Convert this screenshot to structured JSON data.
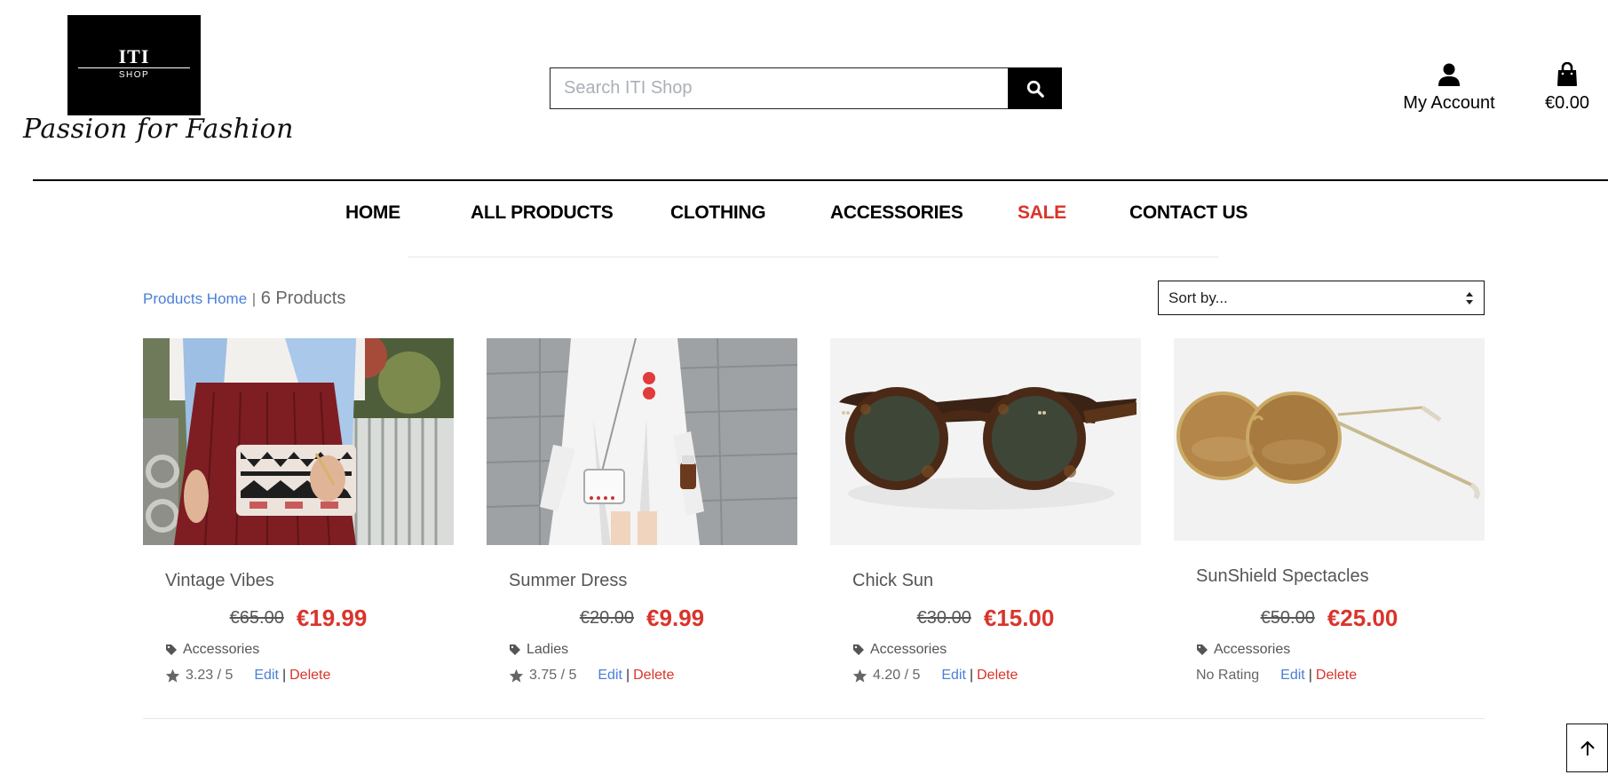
{
  "logo": {
    "brand": "ITI",
    "sub": "SHOP",
    "tagline": "Passion for Fashion"
  },
  "search": {
    "placeholder": "Search ITI Shop",
    "value": "",
    "icon": "search-icon"
  },
  "account": {
    "label": "My Account",
    "icon": "user-icon"
  },
  "cart": {
    "total": "€0.00",
    "icon": "shopping-bag-icon"
  },
  "nav": {
    "items": [
      {
        "label": "HOME"
      },
      {
        "label": "ALL PRODUCTS"
      },
      {
        "label": "CLOTHING"
      },
      {
        "label": "ACCESSORIES"
      },
      {
        "label": "SALE",
        "color": "#d9342b"
      },
      {
        "label": "CONTACT US"
      }
    ]
  },
  "toolbar": {
    "breadcrumb_link": "Products Home",
    "separator": "|",
    "product_count": "6 Products",
    "sort_label": "Sort by..."
  },
  "products": [
    {
      "title": "Vintage Vibes",
      "old_price": "€65.00",
      "price": "€19.99",
      "category": "Accessories",
      "rating": "3.23 / 5",
      "image": "woman-with-clutch-bag"
    },
    {
      "title": "Summer Dress",
      "old_price": "€20.00",
      "price": "€9.99",
      "category": "Ladies",
      "rating": "3.75 / 5",
      "image": "woman-in-white-dress"
    },
    {
      "title": "Chick Sun",
      "old_price": "€30.00",
      "price": "€15.00",
      "category": "Accessories",
      "rating": "4.20 / 5",
      "image": "tortoiseshell-sunglasses"
    },
    {
      "title": "SunShield Spectacles",
      "old_price": "€50.00",
      "price": "€25.00",
      "category": "Accessories",
      "rating": "No Rating",
      "image": "gold-round-sunglasses"
    }
  ],
  "actions": {
    "edit": "Edit",
    "delete": "Delete",
    "separator": "|"
  },
  "colors": {
    "accent_red": "#d9342b",
    "link_blue": "#4a7fd6",
    "text_gray": "#555555"
  }
}
